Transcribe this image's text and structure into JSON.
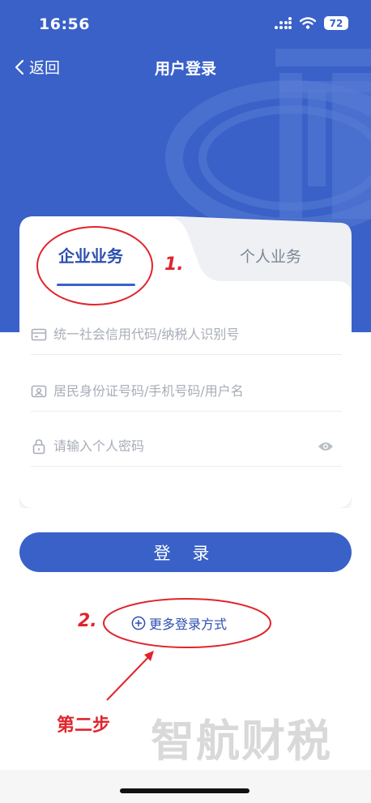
{
  "status_bar": {
    "time": "16:56",
    "battery": "72"
  },
  "nav": {
    "back_label": "返回",
    "title": "用户登录"
  },
  "tabs": {
    "enterprise": "企业业务",
    "personal": "个人业务"
  },
  "form": {
    "credit_code_placeholder": "统一社会信用代码/纳税人识别号",
    "id_placeholder": "居民身份证号码/手机号码/用户名",
    "password_placeholder": "请输入个人密码"
  },
  "login_button": "登 录",
  "more_login": "更多登录方式",
  "annotations": {
    "step1": "1.",
    "step2": "2.",
    "step_label": "第二步"
  },
  "watermark": "智航财税",
  "colors": {
    "primary": "#3961c8",
    "annotation": "#e1242c"
  }
}
